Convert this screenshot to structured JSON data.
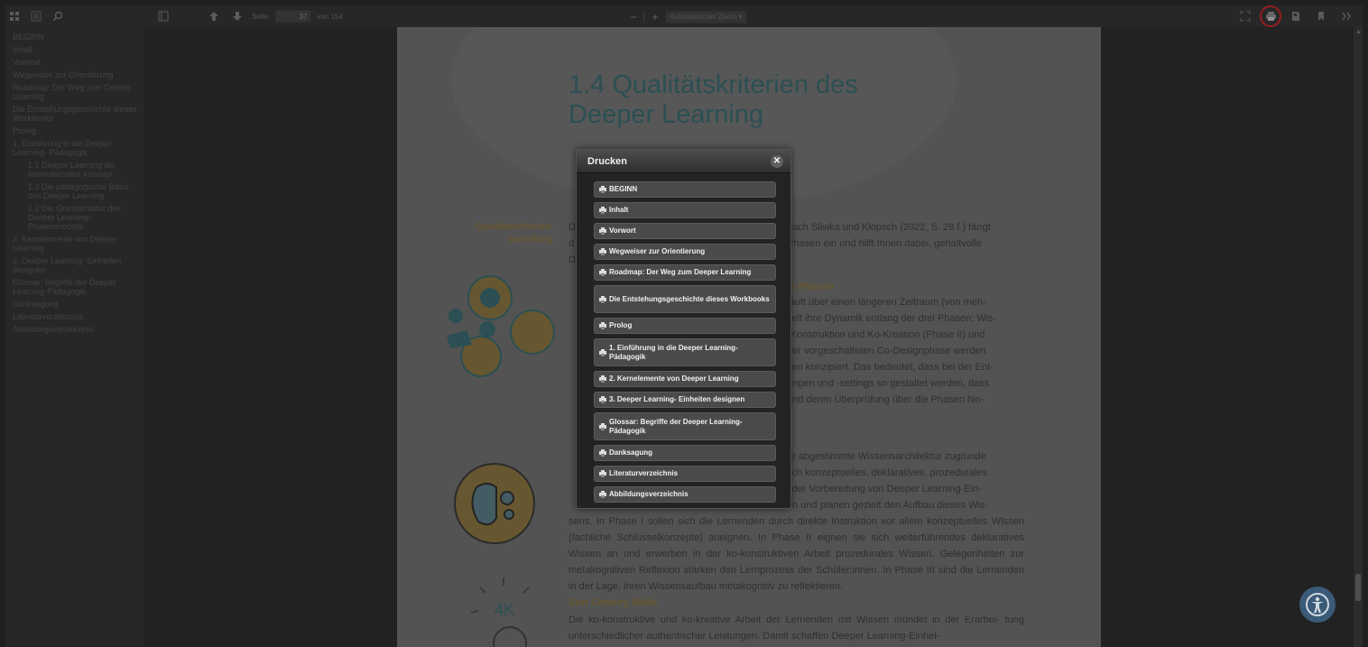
{
  "toolbar": {
    "page_label": "Seite:",
    "page_value": "37",
    "page_total": "von 154",
    "zoom_value": "Automatischer Zoom",
    "icons": [
      "thumbnails-icon",
      "outline-icon",
      "search-icon",
      "sidebar-toggle-icon",
      "previous-page-icon",
      "next-page-icon",
      "zoom-out-icon",
      "zoom-in-icon",
      "presentation-icon",
      "print-icon",
      "download-icon",
      "bookmark-icon",
      "tools-icon"
    ],
    "highlight_color": "#c6272b"
  },
  "sidebar": {
    "items": [
      {
        "label": "BEGINN",
        "level": 0
      },
      {
        "label": "Inhalt",
        "level": 0
      },
      {
        "label": "Vorwort",
        "level": 0
      },
      {
        "label": "Wegweiser zur Orientierung",
        "level": 0
      },
      {
        "label": "Roadmap: Der Weg zum Deeper Learning",
        "level": 0
      },
      {
        "label": "Die Entstehungsgeschichte dieses Workbooks",
        "level": 0
      },
      {
        "label": "Prolog",
        "level": 0
      },
      {
        "label": "1. Einführung in die Deeper Learning- Pädagogik",
        "level": 0
      },
      {
        "label": "1.1 Deeper Learning als internationales Konzept",
        "level": 1
      },
      {
        "label": "1.2 Die pädagogische Basis des Deeper Learning",
        "level": 1
      },
      {
        "label": "1.3 Die Grundstruktur des Deeper Learning- Phasenmodells",
        "level": 1
      },
      {
        "label": "2. Kernelemente von Deeper Learning",
        "level": 0
      },
      {
        "label": "3. Deeper Learning- Einheiten designen",
        "level": 0
      },
      {
        "label": "Glossar: Begriffe der Deeper Learning-Pädagogik",
        "level": 0
      },
      {
        "label": "Danksagung",
        "level": 0
      },
      {
        "label": "Literaturverzeichnis",
        "level": 0
      },
      {
        "label": "Abbildungsverzeichnis",
        "level": 0
      }
    ]
  },
  "page": {
    "heading_line1": "1.4 Qualitätskriterien des",
    "heading_line2": "Deeper Learning",
    "side_label_line1": "Qualitätskriterien-",
    "side_label_line2": "sammlung",
    "intro_right_1": "nach Sliwka und Klopsch (2022, S. 28 f.) fängt",
    "intro_right_2": "Phasen ein und hilft Ihnen dabei, gehaltvolle",
    "intro_left_1": "D",
    "intro_left_2": "d",
    "intro_left_3": "D",
    "section1_heading": "in Phasen",
    "section1_right": [
      "läuft über einen längeren Zeitraum (von meh-",
      "celt ihre Dynamik entlang der drei Phasen: Wis-",
      "-Konstruktion und Ko-Kreation (Phase II) und",
      "der vorgeschalteten Co-Designphase werden",
      "iten konzipiert. Das bedeutet, dass bei der Ent-",
      "ungen und -settings so gestaltet werden, dass",
      "und deren Überprüfung über die Phasen hin-"
    ],
    "section2_right": [
      "er abgestimmte Wissensarchitektur zugrunde.",
      "sch konzeptuelles, deklaratives, prozedurales",
      "i der Vorbereitung von Deeper Learning-Ein-",
      "en und planen gezielt den Aufbau dieses Wis-"
    ],
    "section2_full": "sens. In Phase I sollen sich die Lernenden durch direkte Instruktion vor allem konzeptuelles Wissen (fachliche Schlüsselkonzepte) aneignen. In Phase II eignen sie sich weiterführendes deklaratives Wissen an und erwerben in der ko-konstruktiven Arbeit prozedurales Wissen. Gelegenheiten zur metakognitiven Reflexion stärken den Lernprozess der Schüler:innen. In Phase III sind die Lernenden in der Lage, ihren Wissensaufbau metakognitiv zu reflektieren.",
    "section3_heading": "21st Century Skills",
    "section3_text": "Die ko-konstruktive und ko-kreative Arbeit der Lernenden mit Wissen mündet in der Erarbei- tung unterschiedlicher authentischer Leistungen. Damit schaffen Deeper Learning-Einhei-",
    "graphic_label_4k": "4K"
  },
  "dialog": {
    "title": "Drucken",
    "items": [
      "BEGINN",
      "Inhalt",
      "Vorwort",
      "Wegweiser zur Orientierung",
      "Roadmap: Der Weg zum Deeper Learning",
      "Die Entstehungsgeschichte dieses Workbooks",
      "Prolog",
      "1. Einführung in die Deeper Learning- Pädagogik",
      "2. Kernelemente von Deeper Learning",
      "3. Deeper Learning- Einheiten designen",
      "Glossar: Begriffe der Deeper Learning-Pädagogik",
      "Danksagung",
      "Literaturverzeichnis",
      "Abbildungsverzeichnis"
    ]
  },
  "colors": {
    "heading_teal": "#3a6a6f",
    "accent_orange": "#8a7540",
    "dialog_bg": "#232323",
    "dialog_item_bg": "#4a4a4a"
  }
}
